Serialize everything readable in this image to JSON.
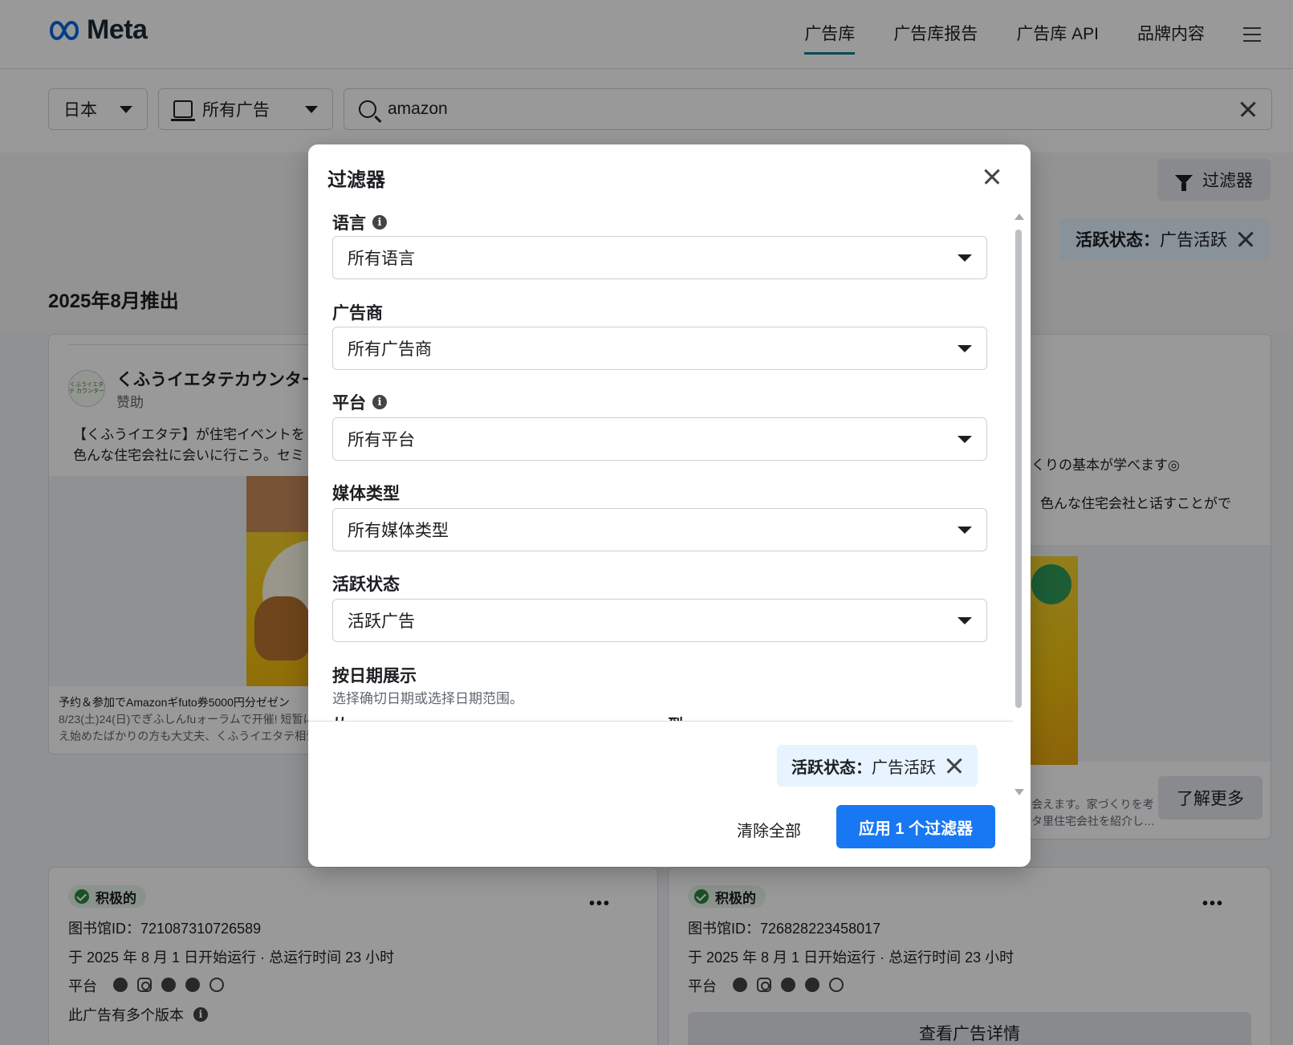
{
  "brand": {
    "name": "Meta"
  },
  "nav": {
    "items": [
      {
        "label": "广告库",
        "active": true
      },
      {
        "label": "广告库报告",
        "active": false
      },
      {
        "label": "广告库 API",
        "active": false
      },
      {
        "label": "品牌内容",
        "active": false
      }
    ]
  },
  "search": {
    "country": "日本",
    "ad_type": "所有广告",
    "query": "amazon"
  },
  "results": {
    "filter_button": "过滤器",
    "active_chip": {
      "key": "活跃状态：",
      "value": "广告活跃"
    },
    "launch_title": "2025年8月推出"
  },
  "ad_card_1": {
    "avatar_text": "くふうイエタテ カウンター",
    "advertiser": "くふうイエタテカウンター",
    "sponsored": "赞助",
    "body_line1": "【くふうイエタテ】が住宅イベントを",
    "body_line2": "色んな住宅会社に会いに行こう。セミ",
    "caption_line1": "予约＆参加でAmazonギfuto券5000円分ゼゼン",
    "caption_line2": "8/23(土)24(日)でぎふしんfuォーラムで开催! 短暂に",
    "caption_line3": "え始めたばかりの方も大丈夫、くふうイエタテ相谈"
  },
  "ad_card_2": {
    "body_line1": "くりの基本が学べます◎",
    "body_line2": "色んな住宅会社と话すことがで",
    "caption_line1": "会えます。家づくりを考",
    "caption_line2": "タ里住宅会社を紹介し…",
    "learn_more": "了解更多"
  },
  "lib_card_1": {
    "status": "积极的",
    "library_id": "图书馆ID：721087310726589",
    "run_info": "于 2025 年 8 月 1 日开始运行 · 总运行时间 23 小时",
    "platform_label": "平台",
    "versions": "此广告有多个版本"
  },
  "lib_card_2": {
    "status": "积极的",
    "library_id": "图书馆ID：726828223458017",
    "run_info": "于 2025 年 8 月 1 日开始运行 · 总运行时间 23 小时",
    "platform_label": "平台",
    "detail_button": "查看广告详情"
  },
  "modal": {
    "title": "过滤器",
    "fields": {
      "language": {
        "label": "语言",
        "value": "所有语言"
      },
      "advertiser": {
        "label": "广告商",
        "value": "所有广告商"
      },
      "platform": {
        "label": "平台",
        "value": "所有平台"
      },
      "media_type": {
        "label": "媒体类型",
        "value": "所有媒体类型"
      },
      "active_status": {
        "label": "活跃状态",
        "value": "活跃广告"
      }
    },
    "date": {
      "label": "按日期展示",
      "help": "选择确切日期或选择日期范围。",
      "from": "从",
      "to": "到"
    },
    "chip": {
      "key": "活跃状态：",
      "value": "广告活跃"
    },
    "clear_all": "清除全部",
    "apply": "应用 1 个过滤器"
  }
}
